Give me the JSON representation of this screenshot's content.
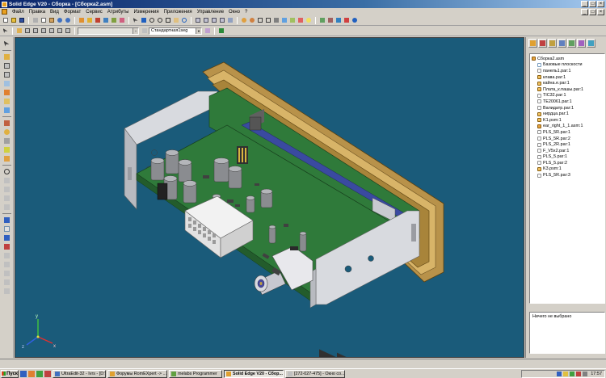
{
  "window": {
    "title": "Solid Edge V20 - Сборка - [Сборка2.asm]",
    "controls": [
      "_",
      "□",
      "×"
    ]
  },
  "menu": {
    "items": [
      "Файл",
      "Правка",
      "Вид",
      "Формат",
      "Сервис",
      "Атрибуты",
      "Измерения",
      "Приложения",
      "Управление",
      "Окно",
      "?"
    ],
    "mdi_controls": [
      "_",
      "□",
      "×"
    ]
  },
  "toolbar2": {
    "layer_combo": "",
    "style_combo": "Стандартная1seg"
  },
  "tree": {
    "items": [
      {
        "label": "Сборка2.asm",
        "level": 0,
        "icon": "asm"
      },
      {
        "label": "Базовые плоскости",
        "level": 1,
        "icon": "plane"
      },
      {
        "label": "панель1.par:1",
        "level": 1,
        "icon": "partw"
      },
      {
        "label": "клава.par:1",
        "level": 1,
        "icon": "part"
      },
      {
        "label": "кайна.e.par:1",
        "level": 1,
        "icon": "part"
      },
      {
        "label": "Плата_к.пашы.par:1",
        "level": 1,
        "icon": "part"
      },
      {
        "label": "TIC32.par:1",
        "level": 1,
        "icon": "partw"
      },
      {
        "label": "TE20061.par:1",
        "level": 1,
        "icon": "partw"
      },
      {
        "label": "Валидатр.par:1",
        "level": 1,
        "icon": "partw"
      },
      {
        "label": "нирдца.par:1",
        "level": 1,
        "icon": "part"
      },
      {
        "label": "K1.psm:1",
        "level": 1,
        "icon": "part"
      },
      {
        "label": "ear_right_1_1.asm:1",
        "level": 1,
        "icon": "asm"
      },
      {
        "label": "PLS_5R.par:1",
        "level": 1,
        "icon": "partw"
      },
      {
        "label": "PLS_5R.par:2",
        "level": 1,
        "icon": "partw"
      },
      {
        "label": "PLS_2R.par:1",
        "level": 1,
        "icon": "partw"
      },
      {
        "label": "F_V5x2.par:1",
        "level": 1,
        "icon": "partw"
      },
      {
        "label": "PLS_5.par:1",
        "level": 1,
        "icon": "partw"
      },
      {
        "label": "PLS_5.par:2",
        "level": 1,
        "icon": "partw"
      },
      {
        "label": "K3.psm:1",
        "level": 1,
        "icon": "part"
      },
      {
        "label": "PLS_5R.par:3",
        "level": 1,
        "icon": "partw"
      }
    ]
  },
  "properties": {
    "status": "Ничего не выбрано"
  },
  "triad": {
    "x": "x",
    "y": "y",
    "z": "z"
  },
  "taskbar": {
    "start": "Пуск",
    "tasks": [
      {
        "label": "UltraEdit-32 - Ivrs - [D:\\...",
        "active": false
      },
      {
        "label": "Форумы RomEXpert -> ...",
        "active": false
      },
      {
        "label": "melabs Programmer",
        "active": false
      },
      {
        "label": "Solid Edge V20 - Сбор...",
        "active": true
      },
      {
        "label": "[272-027-475] - Окно со...",
        "active": false
      }
    ],
    "clock": "17:57"
  },
  "colors": {
    "viewport_bg": "#1a5b7a",
    "pcb_green": "#2f7a3a",
    "frame_gold": "#b8924a",
    "chassis_gray": "#c8cad0"
  }
}
